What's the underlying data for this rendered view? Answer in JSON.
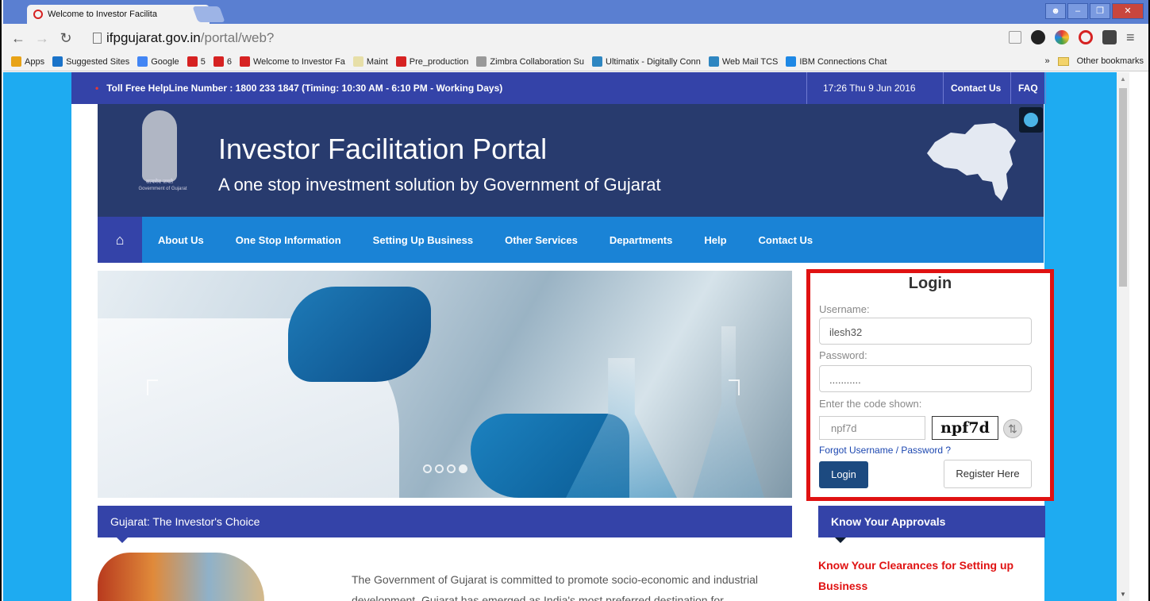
{
  "browser": {
    "tab_title": "Welcome to Investor Facilita",
    "url_host": "ifpgujarat.gov.in",
    "url_path": "/portal/web?"
  },
  "bookmarks": [
    {
      "label": "Apps",
      "color": "#e8a317"
    },
    {
      "label": "Suggested Sites",
      "color": "#1a73c9"
    },
    {
      "label": "Google",
      "color": "#4285f4"
    },
    {
      "label": "5",
      "color": "#d62222"
    },
    {
      "label": "6",
      "color": "#d62222"
    },
    {
      "label": "Welcome to Investor Fa",
      "color": "#d62222"
    },
    {
      "label": "Maint",
      "color": "#e7dfa8"
    },
    {
      "label": "Pre_production",
      "color": "#d62222"
    },
    {
      "label": "Zimbra Collaboration Su",
      "color": "#999999"
    },
    {
      "label": "Ultimatix - Digitally Conn",
      "color": "#2e86c1"
    },
    {
      "label": "Web Mail TCS",
      "color": "#2e86c1"
    },
    {
      "label": "IBM Connections Chat",
      "color": "#1e88e5"
    }
  ],
  "bookmarks_more": "»",
  "bookmarks_other": "Other bookmarks",
  "topbar": {
    "helpline": "Toll Free HelpLine Number : 1800 233 1847 (Timing: 10:30 AM - 6:10 PM - Working Days)",
    "datetime": "17:26  Thu  9 Jun 2016",
    "contact": "Contact Us",
    "faq": "FAQ"
  },
  "banner": {
    "title": "Investor Facilitation Portal",
    "subtitle": "A one stop investment solution by Government of Gujarat",
    "emblem_hindi": "सत्यमेव जयते",
    "emblem_caption": "Government of Gujarat"
  },
  "nav": {
    "items": [
      "About Us",
      "One Stop Information",
      "Setting Up Business",
      "Other Services",
      "Departments",
      "Help",
      "Contact Us"
    ]
  },
  "login": {
    "heading": "Login",
    "username_label": "Username:",
    "username_value": "ilesh32",
    "password_label": "Password:",
    "password_value": "...........",
    "captcha_label": "Enter the code shown:",
    "captcha_input": "npf7d",
    "captcha_image": "npf7d",
    "forgot": "Forgot Username / Password ?",
    "login_button": "Login",
    "register_button": "Register Here"
  },
  "sections": {
    "investor_choice": "Gujarat: The Investor's Choice",
    "approvals": "Know Your Approvals",
    "clearances": "Know Your Clearances for Setting up Business",
    "intro": "The Government of Gujarat is committed to promote socio-economic and industrial development. Gujarat has emerged as India's most preferred destination for"
  },
  "slider": {
    "slides": 4,
    "active_index": 3
  }
}
